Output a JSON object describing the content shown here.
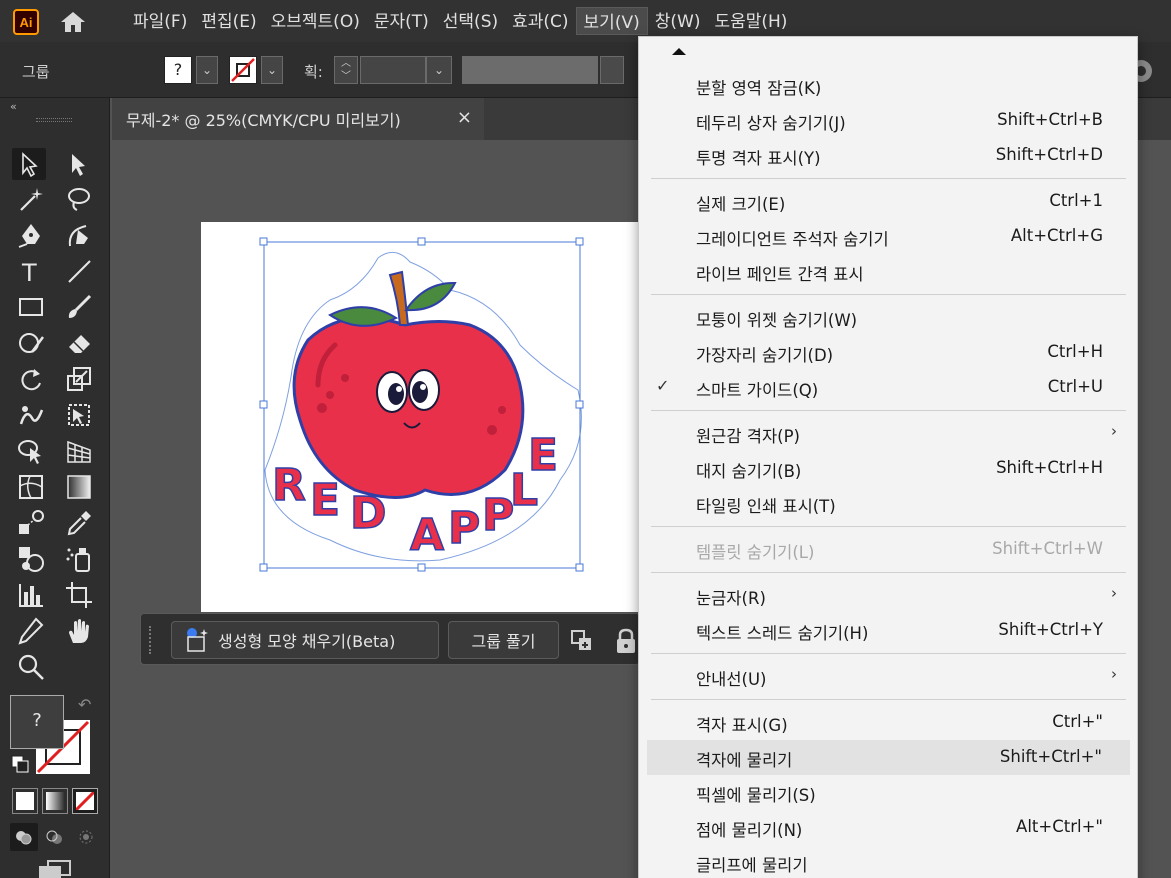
{
  "app": {
    "logo": "Ai"
  },
  "menubar": [
    "파일(F)",
    "편집(E)",
    "오브젝트(O)",
    "문자(T)",
    "선택(S)",
    "효과(C)",
    "보기(V)",
    "창(W)",
    "도움말(H)"
  ],
  "control_bar": {
    "selection_type": "그룹",
    "fill_label": "?",
    "stroke_label": "획:"
  },
  "document_tab": {
    "title": "무제-2* @ 25%(CMYK/CPU 미리보기)",
    "close": "×"
  },
  "artwork": {
    "text": "RED APPLE",
    "colors": {
      "apple": "#e8304a",
      "leaf": "#4a8a3e",
      "stem": "#c86a1e",
      "selection": "#2f5fb8"
    }
  },
  "context_bar": {
    "generative_fill": "생성형 모양 채우기(Beta)",
    "ungroup": "그룹 풀기"
  },
  "fill_stroke": {
    "fill_label": "?"
  },
  "view_menu": {
    "groups": [
      [
        {
          "label": "분할 영역 잠금(K)",
          "shortcut": ""
        },
        {
          "label": "테두리 상자 숨기기(J)",
          "shortcut": "Shift+Ctrl+B"
        },
        {
          "label": "투명 격자 표시(Y)",
          "shortcut": "Shift+Ctrl+D"
        }
      ],
      [
        {
          "label": "실제 크기(E)",
          "shortcut": "Ctrl+1"
        },
        {
          "label": "그레이디언트 주석자 숨기기",
          "shortcut": "Alt+Ctrl+G"
        },
        {
          "label": "라이브 페인트 간격 표시",
          "shortcut": ""
        }
      ],
      [
        {
          "label": "모퉁이 위젯 숨기기(W)",
          "shortcut": ""
        },
        {
          "label": "가장자리 숨기기(D)",
          "shortcut": "Ctrl+H"
        },
        {
          "label": "스마트 가이드(Q)",
          "shortcut": "Ctrl+U",
          "checked": true
        }
      ],
      [
        {
          "label": "원근감 격자(P)",
          "shortcut": "",
          "submenu": true
        },
        {
          "label": "대지 숨기기(B)",
          "shortcut": "Shift+Ctrl+H"
        },
        {
          "label": "타일링 인쇄 표시(T)",
          "shortcut": ""
        }
      ],
      [
        {
          "label": "템플릿 숨기기(L)",
          "shortcut": "Shift+Ctrl+W",
          "disabled": true
        }
      ],
      [
        {
          "label": "눈금자(R)",
          "shortcut": "",
          "submenu": true
        },
        {
          "label": "텍스트 스레드 숨기기(H)",
          "shortcut": "Shift+Ctrl+Y"
        }
      ],
      [
        {
          "label": "안내선(U)",
          "shortcut": "",
          "submenu": true
        }
      ],
      [
        {
          "label": "격자 표시(G)",
          "shortcut": "Ctrl+\""
        },
        {
          "label": "격자에 물리기",
          "shortcut": "Shift+Ctrl+\"",
          "hover": true
        },
        {
          "label": "픽셀에 물리기(S)",
          "shortcut": ""
        },
        {
          "label": "점에 물리기(N)",
          "shortcut": "Alt+Ctrl+\""
        },
        {
          "label": "글리프에 물리기",
          "shortcut": ""
        }
      ]
    ]
  }
}
